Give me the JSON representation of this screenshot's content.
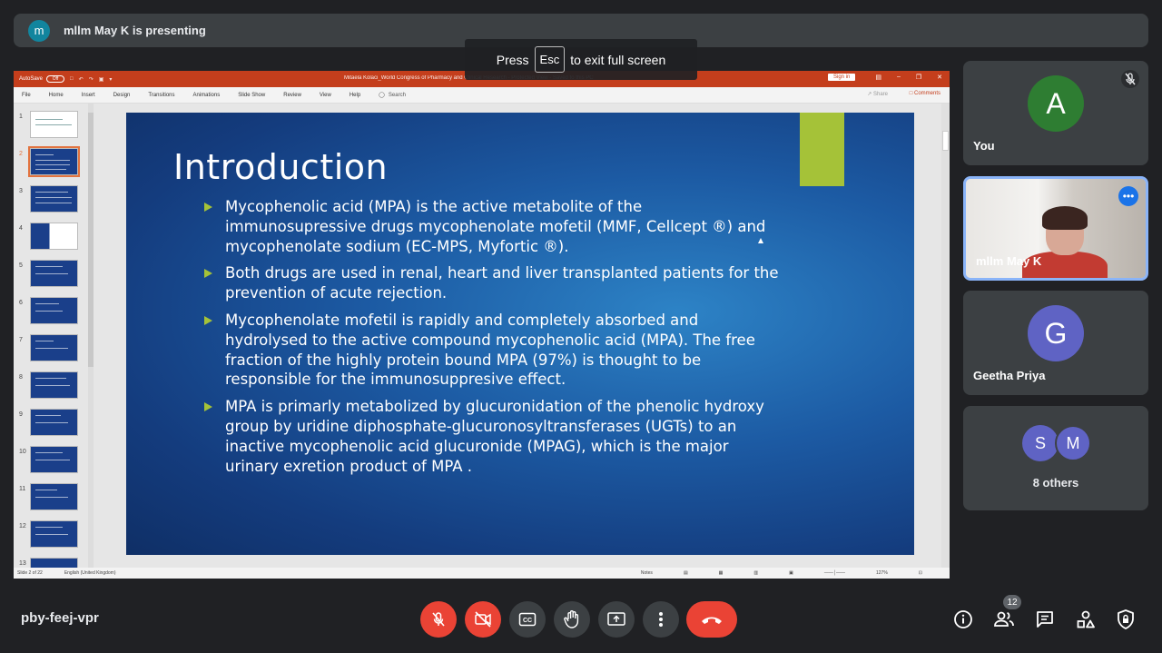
{
  "presenter": {
    "initial": "m",
    "text": "mllm May K is presenting"
  },
  "esc_toast": {
    "press": "Press",
    "key": "Esc",
    "suffix": "to exit full screen"
  },
  "ppt": {
    "autosave": "AutoSave",
    "autosave_state": "Off",
    "doc_title": "Mitaela Kolaci_World Congress of Pharmacy and Clinical Research - Protected View - Saved to this PC",
    "sign_in": "Sign in",
    "menu": [
      "File",
      "Home",
      "Insert",
      "Design",
      "Transitions",
      "Animations",
      "Slide Show",
      "Review",
      "View",
      "Help"
    ],
    "search": "Search",
    "share": "Share",
    "comments": "Comments",
    "slide_numbers": [
      "1",
      "2",
      "3",
      "4",
      "5",
      "6",
      "7",
      "8",
      "9",
      "10",
      "11",
      "12",
      "13"
    ],
    "selected_slide": 2,
    "status_slide": "Slide 2 of 22",
    "status_lang": "English (United Kingdom)",
    "status_notes": "Notes",
    "status_zoom": "127%"
  },
  "slide": {
    "title": "Introduction",
    "bullets": [
      "Mycophenolic acid (MPA) is the active metabolite of the immunosupressive drugs mycophenolate mofetil (MMF, Cellcept ®) and mycophenolate sodium (EC-MPS, Myfortic ®).",
      "Both drugs are used in renal, heart and liver transplanted patients for the prevention of acute rejection.",
      "Mycophenolate mofetil is rapidly and completely absorbed and hydrolysed to the active compound mycophenolic acid (MPA). The free fraction of the highly protein bound MPA (97%) is thought to be responsible for the immunosuppresive effect.",
      "MPA is primarly metabolized by glucuronidation of the phenolic hydroxy group by uridine diphosphate-glucuronosyltransferases (UGTs) to an inactive mycophenolic acid glucuronide (MPAG), which is the major urinary exretion product of MPA ."
    ],
    "accent_color": "#a5c238"
  },
  "participants": {
    "you": {
      "initial": "A",
      "name": "You",
      "color": "#2e7d32"
    },
    "presenter_tile": {
      "name": "mllm May K"
    },
    "geetha": {
      "initial": "G",
      "name": "Geetha Priya",
      "color": "#5f63c4"
    },
    "others": {
      "initials": [
        "S",
        "M"
      ],
      "label": "8 others"
    }
  },
  "bottom_bar": {
    "meeting_code": "pby-feej-vpr",
    "people_count": "12",
    "controls": [
      "mic-off",
      "camera-off",
      "captions",
      "raise-hand",
      "present",
      "more-options",
      "end-call"
    ],
    "right_icons": [
      "info",
      "people",
      "chat",
      "activities",
      "host-controls"
    ]
  }
}
